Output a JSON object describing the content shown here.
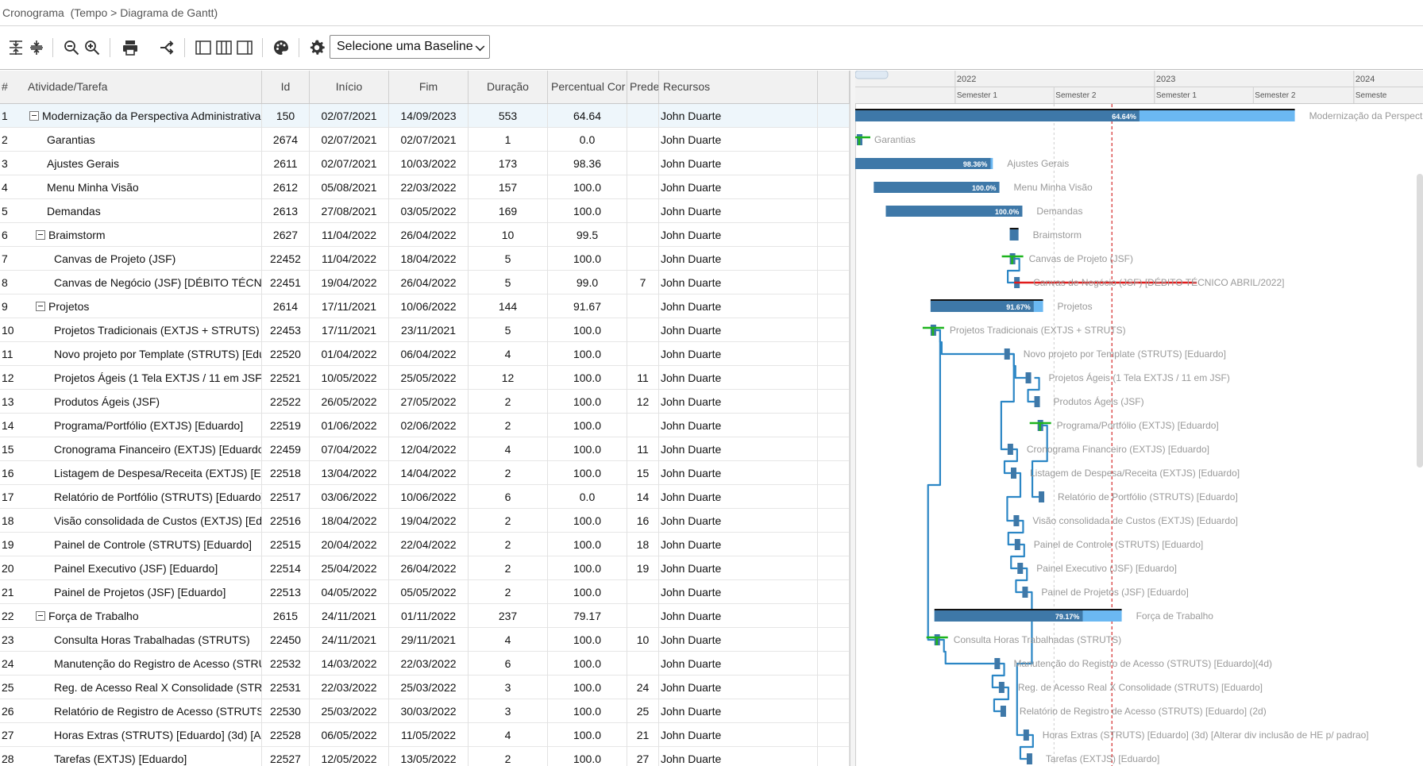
{
  "page": {
    "title": "Cronograma  (Tempo > Diagrama de Gantt)"
  },
  "toolbar": {
    "icons": [
      "expand-all-icon",
      "collapse-all-icon",
      "zoom-out-icon",
      "zoom-in-icon",
      "print-icon",
      "critical-path-icon",
      "layout-grid-only-icon",
      "layout-split-icon",
      "layout-chart-only-icon",
      "palette-icon",
      "gear-icon"
    ],
    "baseline_select": "Selecione uma Baseline"
  },
  "grid": {
    "columns": [
      "#",
      "Atividade/Tarefa",
      "Id",
      "Início",
      "Fim",
      "Duração",
      "Percentual Cor",
      "Prede",
      "Recursos"
    ],
    "rows": [
      {
        "n": "1",
        "task": "Modernização da Perspectiva Administrativa",
        "id": "150",
        "ini": "02/07/2021",
        "fim": "14/09/2023",
        "dur": "553",
        "pct": "64.64",
        "pre": "",
        "rec": "John Duarte"
      },
      {
        "n": "2",
        "task": "Garantias",
        "id": "2674",
        "ini": "02/07/2021",
        "fim": "02/07/2021",
        "dur": "1",
        "pct": "0.0",
        "pre": "",
        "rec": "John Duarte"
      },
      {
        "n": "3",
        "task": "Ajustes Gerais",
        "id": "2611",
        "ini": "02/07/2021",
        "fim": "10/03/2022",
        "dur": "173",
        "pct": "98.36",
        "pre": "",
        "rec": "John Duarte"
      },
      {
        "n": "4",
        "task": "Menu Minha Visão",
        "id": "2612",
        "ini": "05/08/2021",
        "fim": "22/03/2022",
        "dur": "157",
        "pct": "100.0",
        "pre": "",
        "rec": "John Duarte"
      },
      {
        "n": "5",
        "task": "Demandas",
        "id": "2613",
        "ini": "27/08/2021",
        "fim": "03/05/2022",
        "dur": "169",
        "pct": "100.0",
        "pre": "",
        "rec": "John Duarte"
      },
      {
        "n": "6",
        "task": "Braimstorm",
        "id": "2627",
        "ini": "11/04/2022",
        "fim": "26/04/2022",
        "dur": "10",
        "pct": "99.5",
        "pre": "",
        "rec": "John Duarte"
      },
      {
        "n": "7",
        "task": "Canvas de Projeto (JSF)",
        "id": "22452",
        "ini": "11/04/2022",
        "fim": "18/04/2022",
        "dur": "5",
        "pct": "100.0",
        "pre": "",
        "rec": "John Duarte"
      },
      {
        "n": "8",
        "task": "Canvas de Negócio (JSF) [DÉBITO TÉCNICO ABRIL/2022]",
        "id": "22451",
        "ini": "19/04/2022",
        "fim": "26/04/2022",
        "dur": "5",
        "pct": "99.0",
        "pre": "7",
        "rec": "John Duarte"
      },
      {
        "n": "9",
        "task": "Projetos",
        "id": "2614",
        "ini": "17/11/2021",
        "fim": "10/06/2022",
        "dur": "144",
        "pct": "91.67",
        "pre": "",
        "rec": "John Duarte"
      },
      {
        "n": "10",
        "task": "Projetos Tradicionais (EXTJS + STRUTS)",
        "id": "22453",
        "ini": "17/11/2021",
        "fim": "23/11/2021",
        "dur": "5",
        "pct": "100.0",
        "pre": "",
        "rec": "John Duarte"
      },
      {
        "n": "11",
        "task": "Novo projeto por Template (STRUTS) [Eduardo]",
        "id": "22520",
        "ini": "01/04/2022",
        "fim": "06/04/2022",
        "dur": "4",
        "pct": "100.0",
        "pre": "",
        "rec": "John Duarte"
      },
      {
        "n": "12",
        "task": "Projetos Ágeis (1 Tela EXTJS / 11 em JSF)",
        "id": "22521",
        "ini": "10/05/2022",
        "fim": "25/05/2022",
        "dur": "12",
        "pct": "100.0",
        "pre": "11",
        "rec": "John Duarte"
      },
      {
        "n": "13",
        "task": "Produtos Ágeis (JSF)",
        "id": "22522",
        "ini": "26/05/2022",
        "fim": "27/05/2022",
        "dur": "2",
        "pct": "100.0",
        "pre": "12",
        "rec": "John Duarte"
      },
      {
        "n": "14",
        "task": "Programa/Portfólio (EXTJS) [Eduardo]",
        "id": "22519",
        "ini": "01/06/2022",
        "fim": "02/06/2022",
        "dur": "2",
        "pct": "100.0",
        "pre": "",
        "rec": "John Duarte"
      },
      {
        "n": "15",
        "task": "Cronograma Financeiro (EXTJS) [Eduardo]",
        "id": "22459",
        "ini": "07/04/2022",
        "fim": "12/04/2022",
        "dur": "4",
        "pct": "100.0",
        "pre": "11",
        "rec": "John Duarte"
      },
      {
        "n": "16",
        "task": "Listagem de Despesa/Receita (EXTJS) [Eduardo]",
        "id": "22518",
        "ini": "13/04/2022",
        "fim": "14/04/2022",
        "dur": "2",
        "pct": "100.0",
        "pre": "15",
        "rec": "John Duarte"
      },
      {
        "n": "17",
        "task": "Relatório de Portfólio (STRUTS) [Eduardo]",
        "id": "22517",
        "ini": "03/06/2022",
        "fim": "10/06/2022",
        "dur": "6",
        "pct": "0.0",
        "pre": "14",
        "rec": "John Duarte"
      },
      {
        "n": "18",
        "task": "Visão consolidada de Custos (EXTJS) [Eduardo]",
        "id": "22516",
        "ini": "18/04/2022",
        "fim": "19/04/2022",
        "dur": "2",
        "pct": "100.0",
        "pre": "16",
        "rec": "John Duarte"
      },
      {
        "n": "19",
        "task": "Painel de Controle (STRUTS) [Eduardo]",
        "id": "22515",
        "ini": "20/04/2022",
        "fim": "22/04/2022",
        "dur": "2",
        "pct": "100.0",
        "pre": "18",
        "rec": "John Duarte"
      },
      {
        "n": "20",
        "task": "Painel Executivo (JSF) [Eduardo]",
        "id": "22514",
        "ini": "25/04/2022",
        "fim": "26/04/2022",
        "dur": "2",
        "pct": "100.0",
        "pre": "19",
        "rec": "John Duarte"
      },
      {
        "n": "21",
        "task": "Painel de Projetos (JSF) [Eduardo]",
        "id": "22513",
        "ini": "04/05/2022",
        "fim": "05/05/2022",
        "dur": "2",
        "pct": "100.0",
        "pre": "",
        "rec": "John Duarte"
      },
      {
        "n": "22",
        "task": "Força de Trabalho",
        "id": "2615",
        "ini": "24/11/2021",
        "fim": "01/11/2022",
        "dur": "237",
        "pct": "79.17",
        "pre": "",
        "rec": "John Duarte"
      },
      {
        "n": "23",
        "task": "Consulta Horas Trabalhadas (STRUTS)",
        "id": "22450",
        "ini": "24/11/2021",
        "fim": "29/11/2021",
        "dur": "4",
        "pct": "100.0",
        "pre": "10",
        "rec": "John Duarte"
      },
      {
        "n": "24",
        "task": "Manutenção do Registro de Acesso (STRUTS) [Eduardo](4d)",
        "id": "22532",
        "ini": "14/03/2022",
        "fim": "22/03/2022",
        "dur": "6",
        "pct": "100.0",
        "pre": "",
        "rec": "John Duarte"
      },
      {
        "n": "25",
        "task": "Reg. de Acesso Real X Consolidade (STRUTS) [Eduardo]",
        "id": "22531",
        "ini": "22/03/2022",
        "fim": "25/03/2022",
        "dur": "3",
        "pct": "100.0",
        "pre": "24",
        "rec": "John Duarte"
      },
      {
        "n": "26",
        "task": "Relatório de Registro de Acesso (STRUTS) [Eduardo] (2d)",
        "id": "22530",
        "ini": "25/03/2022",
        "fim": "30/03/2022",
        "dur": "3",
        "pct": "100.0",
        "pre": "25",
        "rec": "John Duarte"
      },
      {
        "n": "27",
        "task": "Horas Extras (STRUTS) [Eduardo] (3d) [Alterar div inclusão de HE p/ padrao]",
        "id": "22528",
        "ini": "06/05/2022",
        "fim": "11/05/2022",
        "dur": "4",
        "pct": "100.0",
        "pre": "21",
        "rec": "John Duarte"
      },
      {
        "n": "28",
        "task": "Tarefas (EXTJS) [Eduardo]",
        "id": "22527",
        "ini": "12/05/2022",
        "fim": "13/05/2022",
        "dur": "2",
        "pct": "100.0",
        "pre": "27",
        "rec": "John Duarte"
      }
    ]
  },
  "gantt": {
    "years": [
      "2022",
      "2023",
      "2024"
    ],
    "semesters": [
      "Semester 1",
      "Semester 2",
      "Semester 1",
      "Semester 2",
      "Semeste"
    ],
    "colors": {
      "bar": "#6bb8f2",
      "progress": "#3e78a8",
      "summary": "#111111",
      "link": "#2b86c5",
      "critical": "#e01b1b",
      "milestone": "#1db41d",
      "today": "#cc0000",
      "label": "#999999"
    }
  }
}
